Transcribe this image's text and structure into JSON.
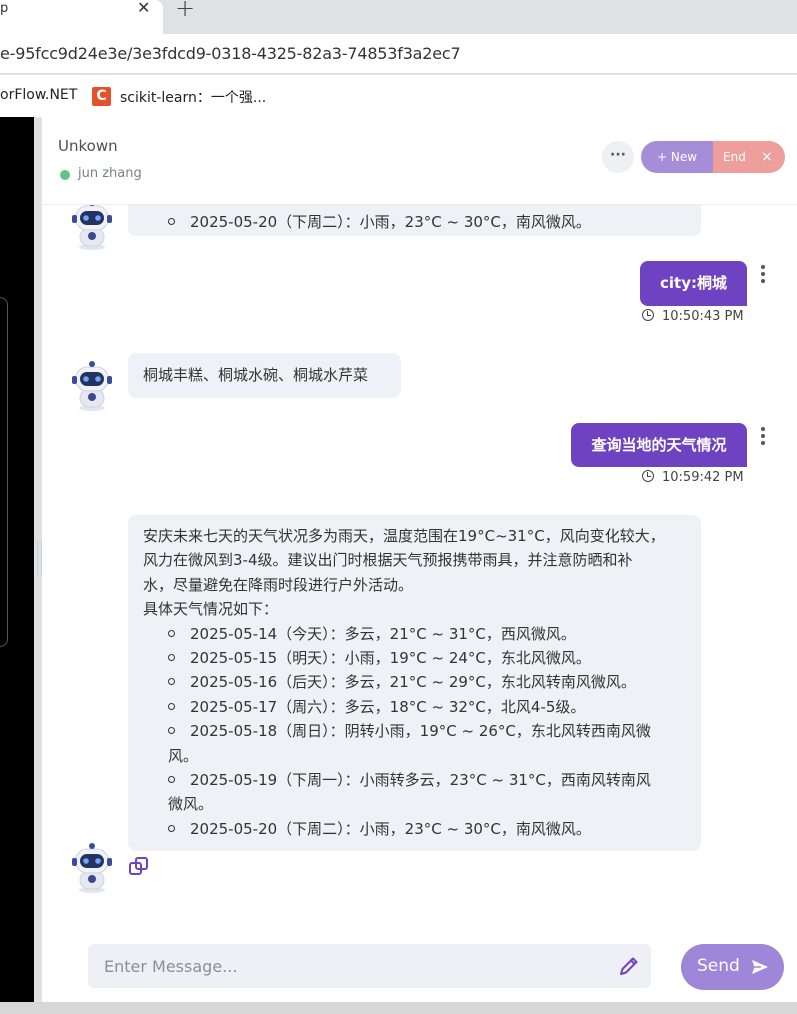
{
  "browser": {
    "tab_title": "p",
    "url": "e-95fcc9d24e3e/3e3fdcd9-0318-4325-82a3-74853f3a2ec7",
    "bookmarks": [
      "orFlow.NET",
      "scikit-learn：一个强..."
    ],
    "sk_icon_letter": "C"
  },
  "header": {
    "title": "Unkown",
    "user": "jun zhang",
    "more_label": "···",
    "new_label": "+ New",
    "end_label": "End",
    "end_close": "×"
  },
  "messages": [
    {
      "role": "bot",
      "lines": [
        "2025-05-20（下周二）：小雨，23°C ~ 30°C，南风微风。"
      ]
    },
    {
      "role": "user",
      "text": "city:桐城",
      "time": "10:50:43 PM"
    },
    {
      "role": "bot",
      "text": "桐城丰糕、桐城水碗、桐城水芹菜"
    },
    {
      "role": "user",
      "text": "查询当地的天气情况",
      "time": "10:59:42 PM"
    },
    {
      "role": "bot",
      "paragraph": [
        "安庆未来七天的天气状况多为雨天，温度范围在19°C~31°C，风向变化较大，",
        "风力在微风到3-4级。建议出门时根据天气预报携带雨具，并注意防晒和补",
        "水，尽量避免在降雨时段进行户外活动。"
      ],
      "subheading": "具体天气情况如下：",
      "items": [
        [
          "2025-05-14（今天）：多云，21°C ~ 31°C，西风微风。"
        ],
        [
          "2025-05-15（明天）：小雨，19°C ~ 24°C，东北风微风。"
        ],
        [
          "2025-05-16（后天）：多云，21°C ~ 29°C，东北风转南风微风。"
        ],
        [
          "2025-05-17（周六）：多云，18°C ~ 32°C，北风4-5级。"
        ],
        [
          "2025-05-18（周日）：阴转小雨，19°C ~ 26°C，东北风转西南风微",
          "风。"
        ],
        [
          "2025-05-19（下周一）：小雨转多云，23°C ~ 31°C，西南风转南风",
          "微风。"
        ],
        [
          "2025-05-20（下周二）：小雨，23°C ~ 30°C，南风微风。"
        ]
      ]
    }
  ],
  "composer": {
    "placeholder": "Enter Message...",
    "send_label": "Send"
  },
  "colors": {
    "accent": "#6f42c1",
    "online": "#5cc683",
    "new_btn": "#a58dd8",
    "end_btn": "#ee9e9b"
  }
}
